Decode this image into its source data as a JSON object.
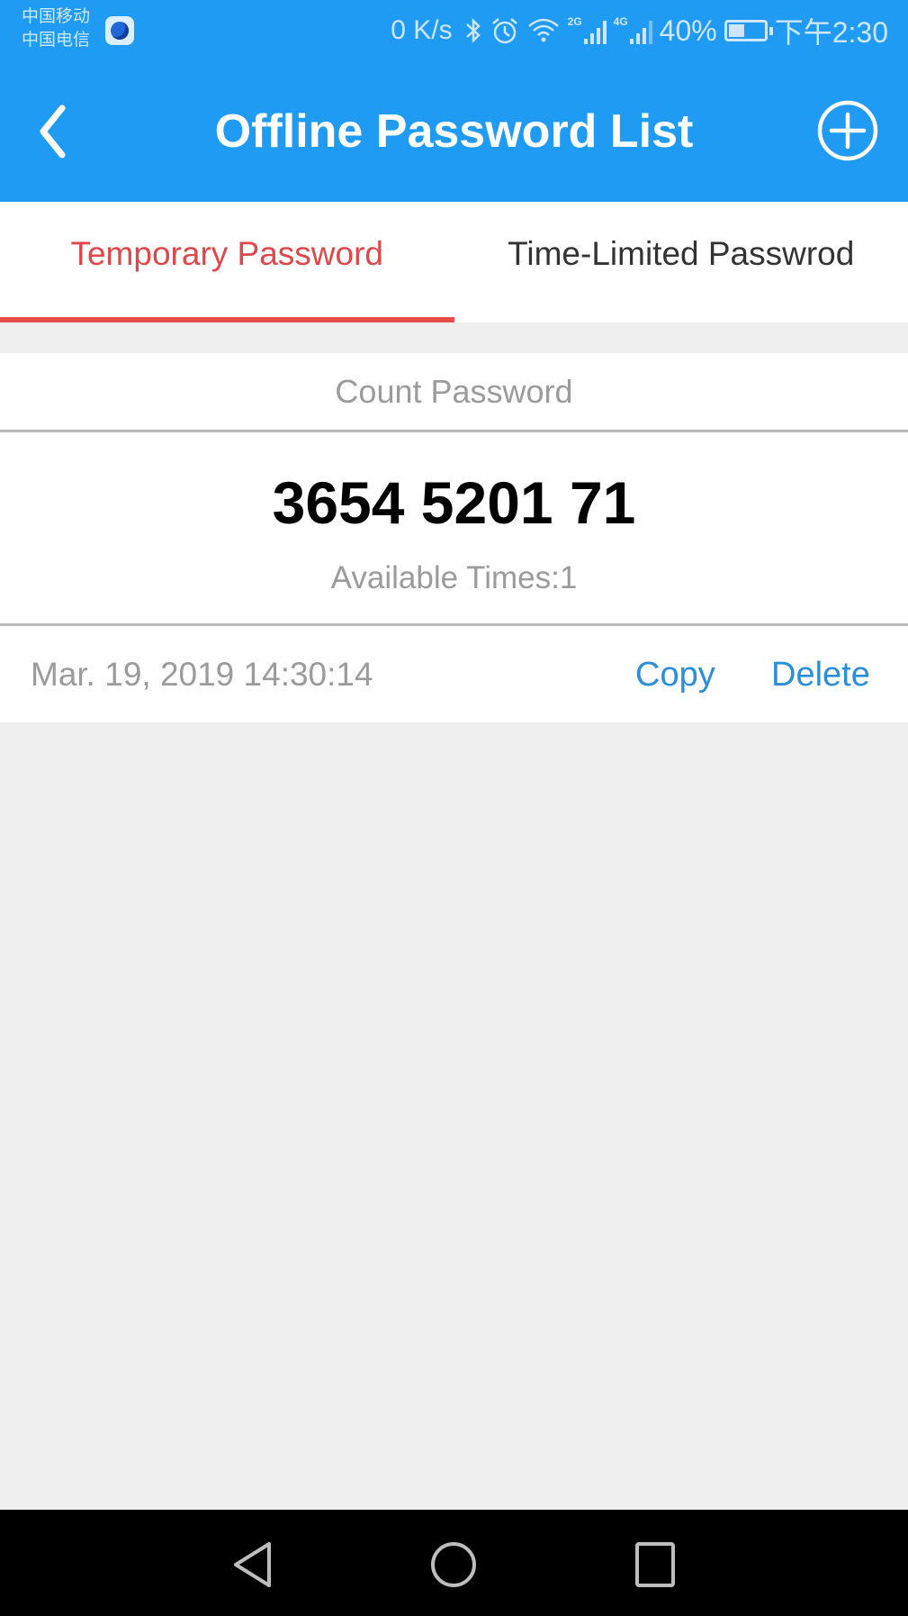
{
  "status_bar": {
    "carriers": [
      "中国移动",
      "中国电信"
    ],
    "app_badge_icon": "blue-app-icon",
    "network_speed": "0 K/s",
    "icons": [
      "bluetooth-icon",
      "alarm-icon",
      "wifi-icon",
      "signal-2g-icon",
      "signal-4g-icon"
    ],
    "signal_labels": [
      "2G",
      "4G"
    ],
    "battery_percent": "40%",
    "battery_level": 0.4,
    "time": "下午2:30"
  },
  "header": {
    "title": "Offline Password List",
    "back_icon": "chevron-left-icon",
    "add_icon": "plus-circle-icon",
    "color": "#1f9bf3"
  },
  "tabs": [
    {
      "label": "Temporary Password",
      "active": true
    },
    {
      "label": "Time-Limited Passwrod",
      "active": false
    }
  ],
  "accent_colors": {
    "active_tab": "#e0474a",
    "link": "#2a8fd8"
  },
  "password_card": {
    "type_label": "Count Password",
    "password": "3654 5201 71",
    "available_times": "Available Times:1",
    "created_at": "Mar. 19, 2019 14:30:14",
    "copy_label": "Copy",
    "delete_label": "Delete"
  },
  "nav_bar": {
    "buttons": [
      "back-triangle-icon",
      "home-circle-icon",
      "recents-square-icon"
    ]
  }
}
